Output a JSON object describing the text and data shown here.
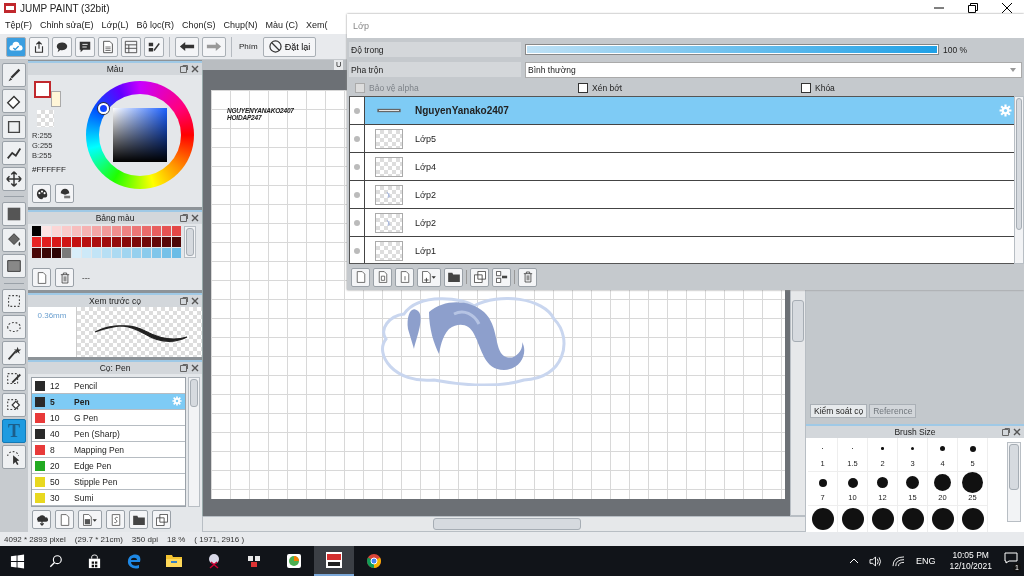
{
  "window": {
    "title": "JUMP PAINT (32bit)"
  },
  "menu": [
    "Tệp(F)",
    "Chỉnh sửa(E)",
    "Lớp(L)",
    "Bộ lọc(R)",
    "Chọn(S)",
    "Chụp(N)",
    "Màu (C)",
    "Xem("
  ],
  "toolbar": {
    "key_label": "Phím",
    "reset_button": "Đặt lại"
  },
  "tool_groups": [
    [
      {
        "kind": "brush",
        "selected": false
      },
      {
        "kind": "eraser",
        "selected": false
      },
      {
        "kind": "rectangle",
        "selected": false
      },
      {
        "kind": "polyline",
        "selected": false
      },
      {
        "kind": "move",
        "selected": false
      }
    ],
    [
      {
        "kind": "fill",
        "selected": false
      },
      {
        "kind": "bucket",
        "selected": false
      },
      {
        "kind": "gradient",
        "selected": false
      }
    ],
    [
      {
        "kind": "select-rect",
        "selected": false
      },
      {
        "kind": "lasso",
        "selected": false
      },
      {
        "kind": "wand",
        "selected": false
      },
      {
        "kind": "select-pen",
        "selected": false
      },
      {
        "kind": "select-eraser",
        "selected": false
      },
      {
        "kind": "text",
        "glyph": "T",
        "selected": true
      },
      {
        "kind": "select-arrow",
        "selected": false
      }
    ]
  ],
  "color_panel": {
    "title": "Màu",
    "current_colors": [
      {
        "color": "#ffffff"
      },
      {
        "color": "#fff6d8"
      }
    ],
    "r": "R:255",
    "g": "G:255",
    "b": "B:255",
    "hex": "#FFFFFF"
  },
  "palette_panel": {
    "title": "Bảng màu",
    "set_name": "---",
    "swatches": [
      {
        "color": "#000000"
      },
      {
        "color": "#fde4e4"
      },
      {
        "color": "#fbd6d6"
      },
      {
        "color": "#f9caca"
      },
      {
        "color": "#f7bebe"
      },
      {
        "color": "#f5b2b2"
      },
      {
        "color": "#f3a6a6"
      },
      {
        "color": "#f19a9a"
      },
      {
        "color": "#ef8e8e"
      },
      {
        "color": "#ed8282"
      },
      {
        "color": "#eb7676"
      },
      {
        "color": "#e96a6a"
      },
      {
        "color": "#e75e5e"
      },
      {
        "color": "#e55252"
      },
      {
        "color": "#e34646"
      },
      {
        "color": "#e82424"
      },
      {
        "color": "#e01e1e"
      },
      {
        "color": "#d81818"
      },
      {
        "color": "#d01414"
      },
      {
        "color": "#c41212"
      },
      {
        "color": "#b81010"
      },
      {
        "color": "#ac0e0e"
      },
      {
        "color": "#a00c0c"
      },
      {
        "color": "#940b0b"
      },
      {
        "color": "#880a0a"
      },
      {
        "color": "#7c0909"
      },
      {
        "color": "#700808"
      },
      {
        "color": "#640707"
      },
      {
        "color": "#580606"
      },
      {
        "color": "#4c0505"
      },
      {
        "color": "#4a0808"
      },
      {
        "color": "#3c0606"
      },
      {
        "color": "#2e0404"
      },
      {
        "color": "#7a7a7a"
      },
      {
        "color": "#d8eefa"
      },
      {
        "color": "#cde9f8"
      },
      {
        "color": "#c2e4f6"
      },
      {
        "color": "#b7dff4"
      },
      {
        "color": "#acdaf2"
      },
      {
        "color": "#a1d5f0"
      },
      {
        "color": "#96d0ee"
      },
      {
        "color": "#8bcbec"
      },
      {
        "color": "#80c6ea"
      },
      {
        "color": "#75c1e8"
      },
      {
        "color": "#6abce6"
      }
    ]
  },
  "brush_preview": {
    "title": "Xem trước cọ",
    "size": "0.36mm"
  },
  "brush_panel": {
    "title": "Cọ: Pen",
    "brushes": [
      {
        "color": "#2a2a2a",
        "size": "12",
        "name": "Pencil",
        "selected": false
      },
      {
        "color": "#2a2a2a",
        "size": "5",
        "name": "Pen",
        "selected": true
      },
      {
        "color": "#e83a3a",
        "size": "10",
        "name": "G Pen",
        "selected": false
      },
      {
        "color": "#2a2a2a",
        "size": "40",
        "name": "Pen (Sharp)",
        "selected": false
      },
      {
        "color": "#e83a3a",
        "size": "8",
        "name": "Mapping Pen",
        "selected": false
      },
      {
        "color": "#22aa22",
        "size": "20",
        "name": "Edge Pen",
        "selected": false
      },
      {
        "color": "#e8d820",
        "size": "50",
        "name": "Stipple Pen",
        "selected": false
      },
      {
        "color": "#e8d820",
        "size": "30",
        "name": "Sumi",
        "selected": false
      }
    ]
  },
  "canvas": {
    "tab": "U",
    "texts": [
      "NGUYENYANAKO2407",
      "HOIDAP247"
    ]
  },
  "layer_panel": {
    "title": "Lớp",
    "opacity_label": "Độ trong",
    "opacity": {
      "level": 1
    },
    "opacity_reading": "100 %",
    "blend_label": "Pha trộn",
    "blend_value": "Bình thường",
    "options": [
      {
        "label": "Bảo vệ alpha",
        "checked": false,
        "disabled": true
      },
      {
        "label": "Xén bớt",
        "checked": false,
        "disabled": false
      },
      {
        "label": "Khóa",
        "checked": false,
        "disabled": false
      }
    ],
    "layers": [
      {
        "name": "NguyenYanako2407",
        "kind": "text",
        "selected": true
      },
      {
        "name": "Lớp5",
        "kind": "empty",
        "selected": false
      },
      {
        "name": "Lớp4",
        "kind": "empty",
        "selected": false
      },
      {
        "name": "Lớp2",
        "kind": "sketch",
        "selected": false
      },
      {
        "name": "Lớp2",
        "kind": "sketch",
        "selected": false
      },
      {
        "name": "Lớp1",
        "kind": "empty",
        "selected": false
      }
    ]
  },
  "right_panel": {
    "tabs": [
      {
        "label": "Kiểm soát cọ",
        "selected": true
      },
      {
        "label": "Reference",
        "selected": false
      }
    ],
    "brush_size": {
      "title": "Brush Size",
      "sizes": [
        "1",
        "1.5",
        "2",
        "3",
        "4",
        "5",
        "7",
        "10",
        "12",
        "15",
        "20",
        "25"
      ]
    }
  },
  "status_bar": [
    "4092 * 2893 pixel",
    "(29.7 * 21cm)",
    "350 dpi",
    "18 %",
    "( 1971, 2916 )"
  ],
  "taskbar": {
    "language": "ENG",
    "time": "10:05 PM",
    "date": "12/10/2021",
    "notification_count": "1"
  }
}
